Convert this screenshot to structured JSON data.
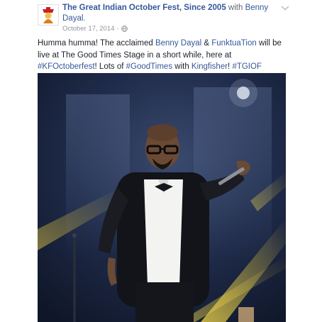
{
  "post": {
    "page_name": "The Great Indian October Fest, Since 2005",
    "with_label": "with",
    "tagged_name": "Benny Dayal",
    "period": ".",
    "timestamp": "October 17, 2014",
    "meta_sep": "·",
    "privacy_icon": "globe-icon",
    "options_icon": "chevron-down-icon",
    "avatar_icon": "october-fest-logo-icon"
  },
  "message": {
    "p1": "Humma humma! The acclaimed ",
    "l1": "Benny Dayal",
    "p2": " & ",
    "l2": "FunktuaTion",
    "p3": " will be live at The Good Times Stage in a short while, here at ",
    "l3": "#KFOctoberfest",
    "p4": "! Lots of ",
    "l4": "#GoodTimes",
    "p5": " with ",
    "l5": "Kingfisher",
    "p6": "! ",
    "l6": "#TGIOF"
  },
  "colors": {
    "link": "#365899",
    "text": "#1d2129",
    "meta": "#90949c",
    "photo_bg": "#17233e",
    "stage_light": "#d9c23a"
  }
}
